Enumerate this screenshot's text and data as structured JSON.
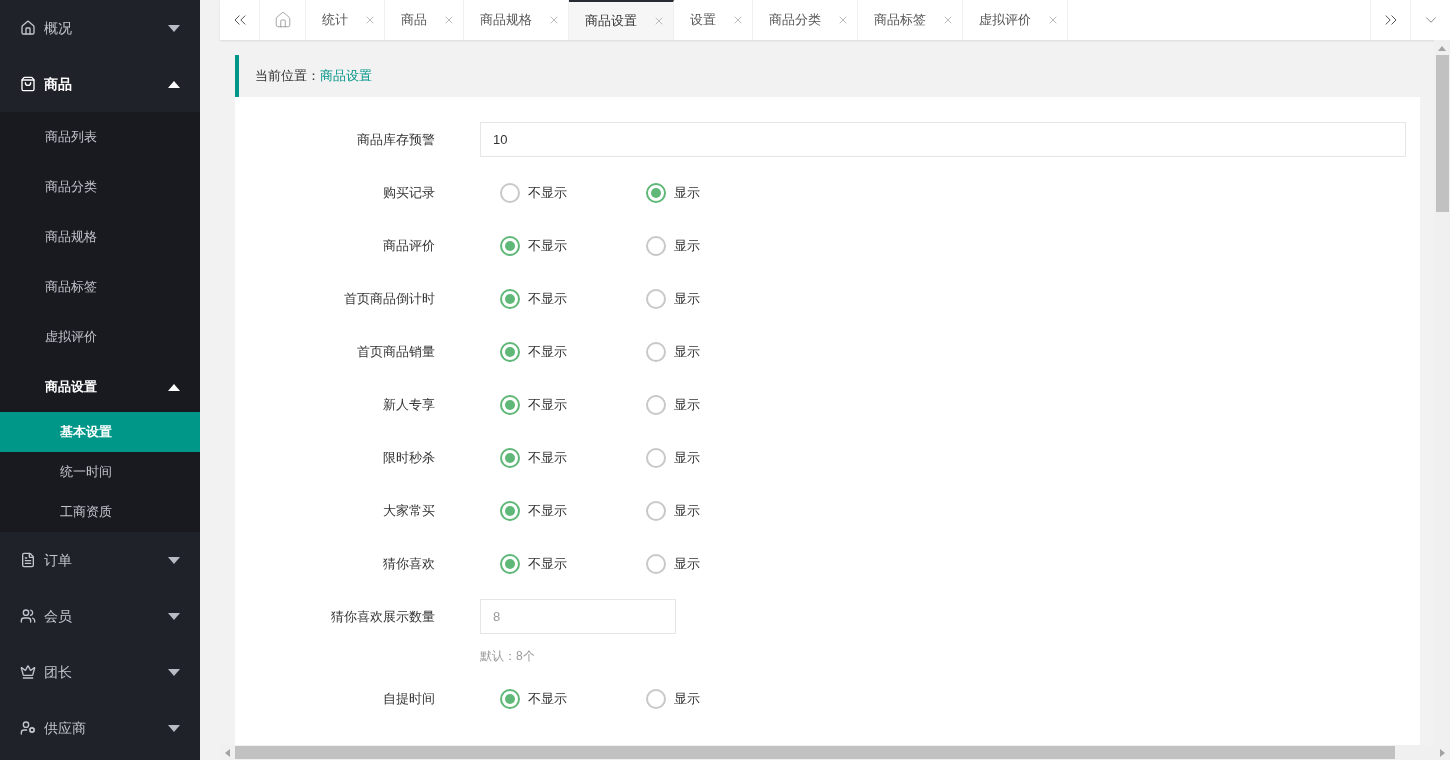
{
  "sidebar": {
    "items": [
      {
        "label": "概况",
        "expanded": false
      },
      {
        "label": "商品",
        "expanded": true,
        "children": [
          {
            "label": "商品列表",
            "selected": false
          },
          {
            "label": "商品分类",
            "selected": false
          },
          {
            "label": "商品规格",
            "selected": false
          },
          {
            "label": "商品标签",
            "selected": false
          },
          {
            "label": "虚拟评价",
            "selected": false
          },
          {
            "label": "商品设置",
            "selected": false,
            "expanded": true,
            "children": [
              {
                "label": "基本设置",
                "selected": true
              },
              {
                "label": "统一时间",
                "selected": false
              },
              {
                "label": "工商资质",
                "selected": false
              }
            ]
          }
        ]
      },
      {
        "label": "订单",
        "expanded": false
      },
      {
        "label": "会员",
        "expanded": false
      },
      {
        "label": "团长",
        "expanded": false
      },
      {
        "label": "供应商",
        "expanded": false
      }
    ]
  },
  "tabs": [
    {
      "label": "统计",
      "selected": false
    },
    {
      "label": "商品",
      "selected": false
    },
    {
      "label": "商品规格",
      "selected": false
    },
    {
      "label": "商品设置",
      "selected": true
    },
    {
      "label": "设置",
      "selected": false
    },
    {
      "label": "商品分类",
      "selected": false
    },
    {
      "label": "商品标签",
      "selected": false
    },
    {
      "label": "虚拟评价",
      "selected": false
    }
  ],
  "breadcrumb": {
    "prefix": "当前位置：",
    "current": "商品设置"
  },
  "form": [
    {
      "kind": "input",
      "label": "商品库存预警",
      "value": "10"
    },
    {
      "kind": "radio",
      "label": "购买记录",
      "options": [
        {
          "label": "不显示",
          "selected": false
        },
        {
          "label": "显示",
          "selected": true
        }
      ]
    },
    {
      "kind": "radio",
      "label": "商品评价",
      "options": [
        {
          "label": "不显示",
          "selected": true
        },
        {
          "label": "显示",
          "selected": false
        }
      ]
    },
    {
      "kind": "radio",
      "label": "首页商品倒计时",
      "options": [
        {
          "label": "不显示",
          "selected": true
        },
        {
          "label": "显示",
          "selected": false
        }
      ]
    },
    {
      "kind": "radio",
      "label": "首页商品销量",
      "options": [
        {
          "label": "不显示",
          "selected": true
        },
        {
          "label": "显示",
          "selected": false
        }
      ]
    },
    {
      "kind": "radio",
      "label": "新人专享",
      "options": [
        {
          "label": "不显示",
          "selected": true
        },
        {
          "label": "显示",
          "selected": false
        }
      ]
    },
    {
      "kind": "radio",
      "label": "限时秒杀",
      "options": [
        {
          "label": "不显示",
          "selected": true
        },
        {
          "label": "显示",
          "selected": false
        }
      ]
    },
    {
      "kind": "radio",
      "label": "大家常买",
      "options": [
        {
          "label": "不显示",
          "selected": true
        },
        {
          "label": "显示",
          "selected": false
        }
      ]
    },
    {
      "kind": "radio",
      "label": "猜你喜欢",
      "options": [
        {
          "label": "不显示",
          "selected": true
        },
        {
          "label": "显示",
          "selected": false
        }
      ]
    },
    {
      "kind": "input_short",
      "label": "猜你喜欢展示数量",
      "placeholder": "8",
      "hint": "默认：8个"
    },
    {
      "kind": "radio",
      "label": "自提时间",
      "options": [
        {
          "label": "不显示",
          "selected": true
        },
        {
          "label": "显示",
          "selected": false
        }
      ]
    }
  ]
}
